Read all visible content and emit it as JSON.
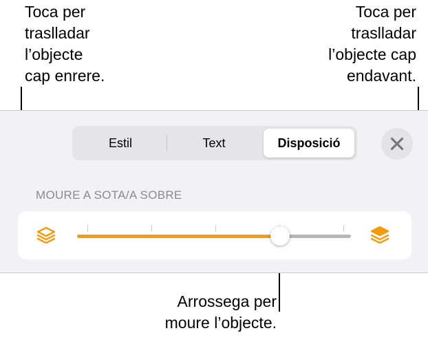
{
  "callouts": {
    "left": "Toca per\ntraslladar\nl’objecte\ncap enrere.",
    "right": "Toca per\ntraslladar\nl’objecte cap\nendavant.",
    "bottom": "Arrossega per\nmoure l’objecte."
  },
  "tabs": [
    {
      "label": "Estil",
      "selected": false
    },
    {
      "label": "Text",
      "selected": false
    },
    {
      "label": "Disposició",
      "selected": true
    }
  ],
  "close_icon": "close-icon",
  "section_label": "MOURE A SOTA/A SOBRE",
  "slider": {
    "value_fraction": 0.74,
    "tick_count": 5,
    "back_icon": "send-backward-icon",
    "front_icon": "bring-forward-icon"
  },
  "colors": {
    "accent": "#f59b0f",
    "panel_bg": "#f2f2f6",
    "track": "#b6b6bb"
  }
}
